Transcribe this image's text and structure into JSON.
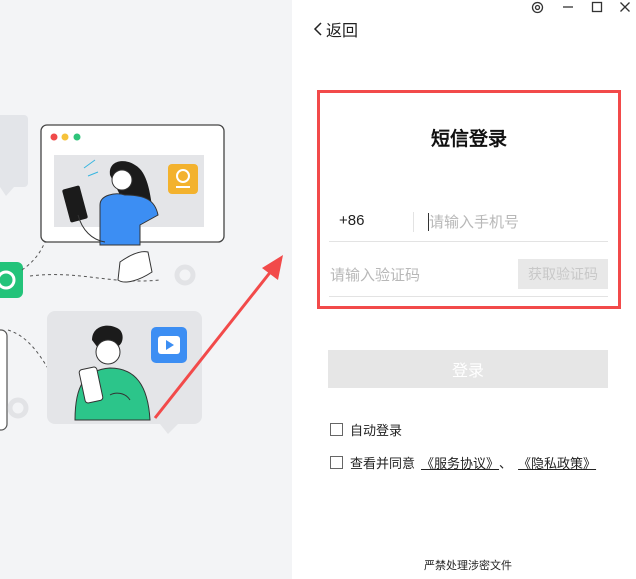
{
  "window_controls": {
    "settings": "settings-icon",
    "minimize": "minimize-icon",
    "maximize": "maximize-icon",
    "close": "close-icon"
  },
  "nav": {
    "back_label": "返回"
  },
  "login": {
    "title": "短信登录",
    "country_code": "+86",
    "phone_placeholder": "请输入手机号",
    "code_placeholder": "请输入验证码",
    "get_code_label": "获取验证码",
    "login_button": "登录"
  },
  "options": {
    "auto_login": "自动登录",
    "agree_prefix": "查看并同意",
    "service_agreement": "《服务协议》",
    "separator": "、",
    "privacy_policy": "《隐私政策》"
  },
  "footer": {
    "text": "严禁处理涉密文件"
  },
  "colors": {
    "highlight_border": "#f24a4a",
    "button_disabled": "#e6e6e6",
    "panel_bg": "#f3f4f6"
  }
}
